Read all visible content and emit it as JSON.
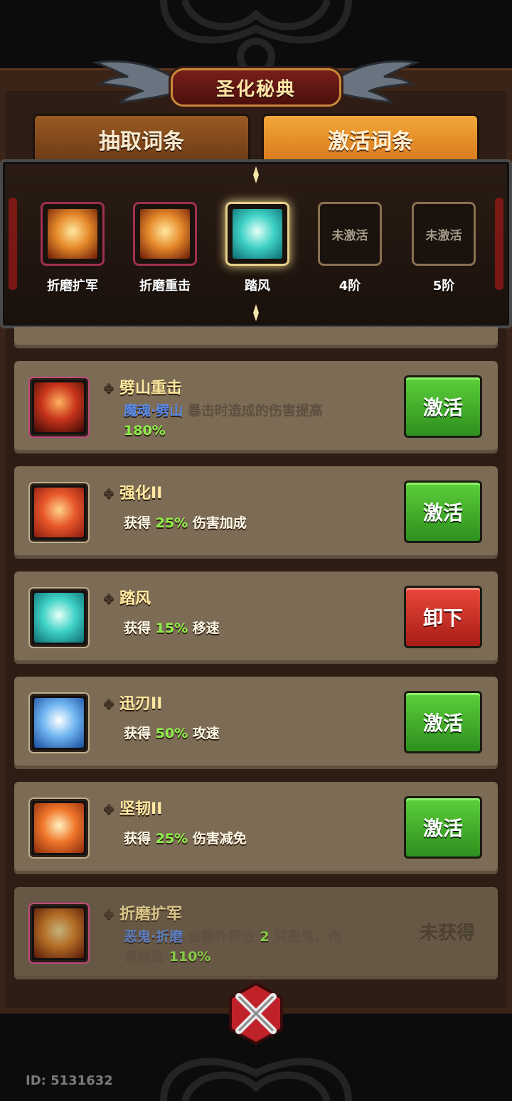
{
  "title": "圣化秘典",
  "tabs": [
    {
      "label": "抽取词条",
      "active": false
    },
    {
      "label": "激活词条",
      "active": true
    }
  ],
  "slots": [
    {
      "label": "折磨扩军",
      "state": "filled",
      "icon": "demon-fire-icon"
    },
    {
      "label": "折磨重击",
      "state": "filled",
      "icon": "demon-fire-icon"
    },
    {
      "label": "踏风",
      "state": "selected",
      "icon": "wind-boot-icon"
    },
    {
      "label": "4阶",
      "state": "locked",
      "locked_text": "未激活"
    },
    {
      "label": "5阶",
      "state": "locked",
      "locked_text": "未激活"
    }
  ],
  "entries": [
    {
      "name": "劈山重击",
      "tag": "魔魂·劈山",
      "desc": "暴击时造成的伤害提高",
      "value": "180%",
      "button": "激活",
      "button_type": "activate",
      "icon": "demon-lord-icon"
    },
    {
      "name": "强化II",
      "prefix": "获得",
      "value": "25%",
      "suffix": "伤害加成",
      "button": "激活",
      "button_type": "activate",
      "icon": "power-fist-icon"
    },
    {
      "name": "踏风",
      "prefix": "获得",
      "value": "15%",
      "suffix": "移速",
      "button": "卸下",
      "button_type": "unequip",
      "icon": "wind-boot-icon"
    },
    {
      "name": "迅刃II",
      "prefix": "获得",
      "value": "50%",
      "suffix": "攻速",
      "button": "激活",
      "button_type": "activate",
      "icon": "swift-blade-icon"
    },
    {
      "name": "坚韧II",
      "prefix": "获得",
      "value": "25%",
      "suffix": "伤害减免",
      "button": "激活",
      "button_type": "activate",
      "icon": "shield-star-icon"
    },
    {
      "name": "折磨扩军",
      "tag": "恶鬼·折磨",
      "desc_a": "会额外释放",
      "count": "2",
      "desc_b": "只恶鬼，伤",
      "desc_c": "害提高",
      "value": "110%",
      "status": "未获得",
      "icon": "demon-fire-icon"
    }
  ],
  "player_id": "ID: 5131632",
  "colors": {
    "accent_green": "#8ef04a",
    "tag_blue": "#5a8ae8",
    "activate_button": "#3fae2a",
    "unequip_button": "#c8302a"
  }
}
